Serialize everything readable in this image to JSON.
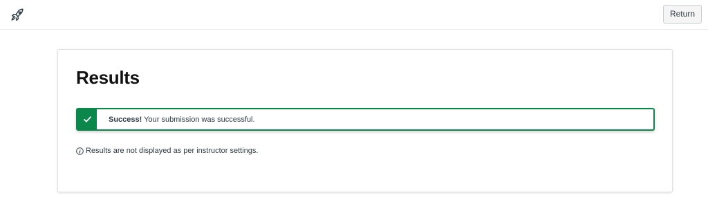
{
  "header": {
    "logo_icon": "rocket-icon",
    "return_label": "Return"
  },
  "results": {
    "title": "Results",
    "alert": {
      "status_icon": "checkmark-icon",
      "strong": "Success!",
      "message": " Your submission was successful.",
      "color": "#0b874b"
    },
    "info": {
      "icon": "info-icon",
      "text": "Results are not displayed as per instructor settings."
    }
  }
}
